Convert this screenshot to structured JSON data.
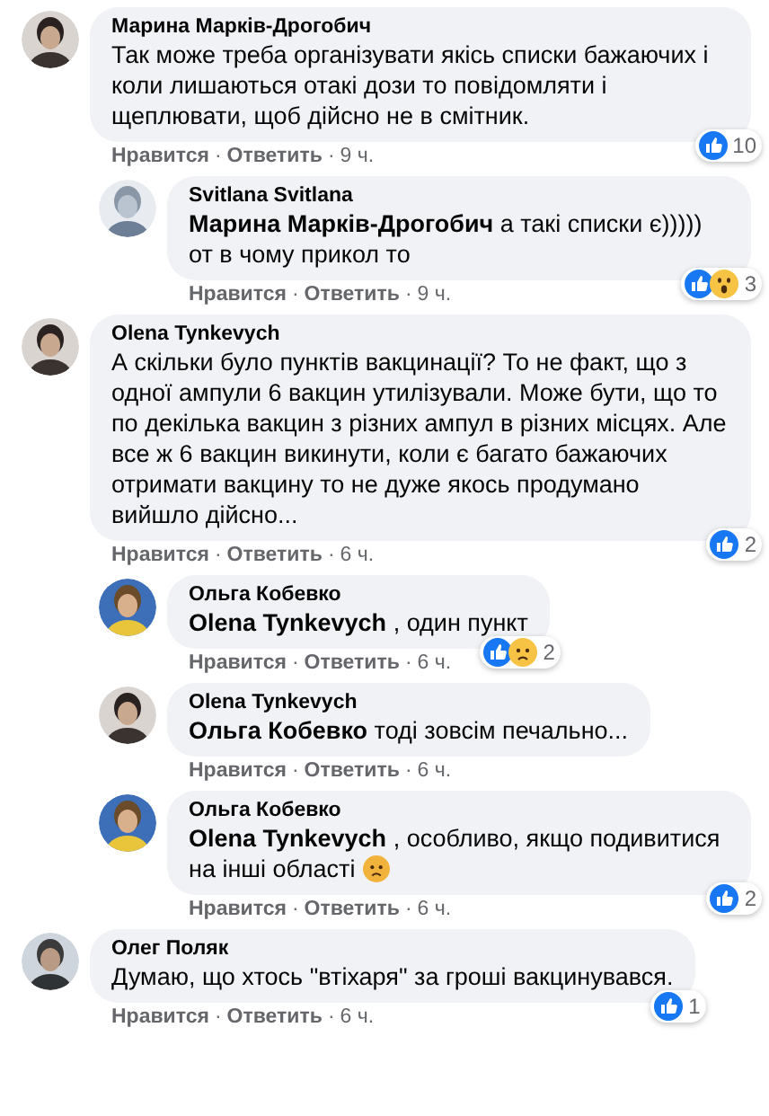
{
  "separator": "·",
  "comments": [
    {
      "author": "Марина Марків-Дрогобич",
      "text": "Так може треба організувати якісь списки бажаючих і коли лишаються отакі дози то повідомляти і щеплювати, щоб дійсно не в смітник.",
      "reactions": [
        {
          "kind": "like"
        }
      ],
      "reaction_count": "10",
      "actions": [
        "Нравится",
        "Ответить"
      ],
      "time": "9 ч.",
      "children": [
        {
          "author": "Svitlana Svitlana",
          "text": "**Марина Марків-Дрогобич** а такі списки є))))) от в чому прикол то",
          "reactions": [
            {
              "kind": "like"
            },
            {
              "kind": "wow"
            }
          ],
          "reaction_count": "3",
          "actions": [
            "Нравится",
            "Ответить"
          ],
          "time": "9 ч."
        }
      ]
    },
    {
      "author": "Olena Tynkevych",
      "text": "А скільки було пунктів вакцинації? То не факт, що з одної ампули 6 вакцин утилізували. Може бути, що то по декілька вакцин з різних ампул в різних місцях. Але все ж 6 вакцин викинути, коли є багато бажаючих отримати вакцину то не дуже якось продумано вийшло дійсно...",
      "reactions": [
        {
          "kind": "like"
        }
      ],
      "reaction_count": "2",
      "actions": [
        "Нравится",
        "Ответить"
      ],
      "time": "6 ч.",
      "children": [
        {
          "author": "Ольга Кобевко",
          "text": "**Olena Tynkevych** , один пункт",
          "reactions": [
            {
              "kind": "like"
            },
            {
              "kind": "sad"
            }
          ],
          "reaction_count": "2",
          "actions": [
            "Нравится",
            "Ответить"
          ],
          "time": "6 ч."
        },
        {
          "author": "Olena Tynkevych",
          "text": "**Ольга Кобевко** тоді зовсім печально...",
          "actions": [
            "Нравится",
            "Ответить"
          ],
          "time": "6 ч."
        },
        {
          "author": "Ольга Кобевко",
          "text": "**Olena Tynkevych** , особливо, якщо подивитися на інші області",
          "trailing_emoji": true,
          "reactions": [
            {
              "kind": "like"
            }
          ],
          "reaction_count": "2",
          "actions": [
            "Нравится",
            "Ответить"
          ],
          "time": "6 ч."
        }
      ]
    },
    {
      "author": "Олег Поляк",
      "text": "Думаю, що хтось \"втіхаря\" за гроші вакцинувався.",
      "reactions": [
        {
          "kind": "like"
        }
      ],
      "reaction_count": "1",
      "actions": [
        "Нравится",
        "Ответить"
      ],
      "time": "6 ч."
    }
  ]
}
